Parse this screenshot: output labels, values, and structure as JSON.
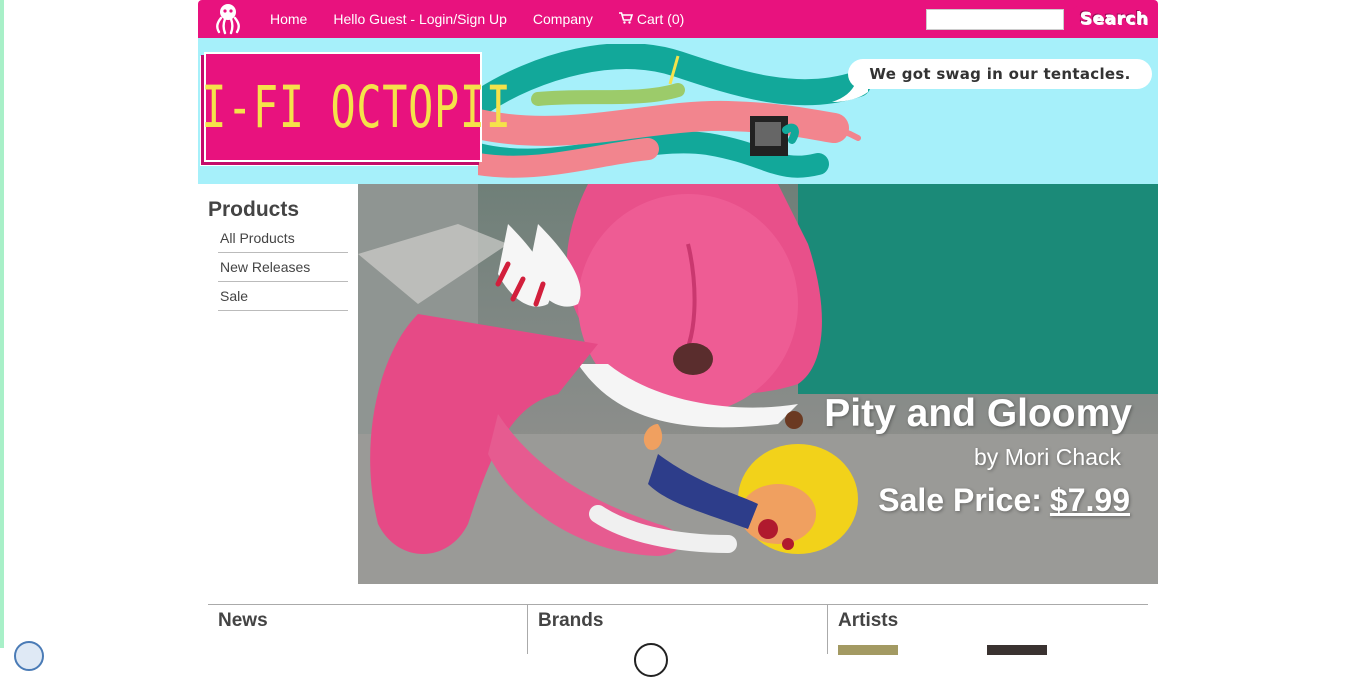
{
  "topnav": {
    "logo_icon": "octopus-icon",
    "links": {
      "home": "Home",
      "login": "Hello Guest - Login/Sign Up",
      "company": "Company",
      "cart": "Cart (0)"
    },
    "cart_icon": "shopping-cart-icon",
    "search": {
      "value": "",
      "button_label": "Search"
    }
  },
  "banner": {
    "logo_text": "HI-FI OCTOPII",
    "tagline": "We got swag in our tentacles."
  },
  "sidebar": {
    "title": "Products",
    "items": [
      {
        "label": "All Products"
      },
      {
        "label": "New Releases"
      },
      {
        "label": "Sale"
      }
    ]
  },
  "hero": {
    "title": "Pity and Gloomy",
    "by": "by Mori Chack",
    "price_label": "Sale Price:",
    "price_value": "$7.99"
  },
  "bottom": {
    "news": "News",
    "brands": "Brands",
    "artists": "Artists"
  },
  "colors": {
    "nav_pink": "#e8127e",
    "banner_blue": "#a6f0fa",
    "logo_yellow": "#f5e24a"
  }
}
